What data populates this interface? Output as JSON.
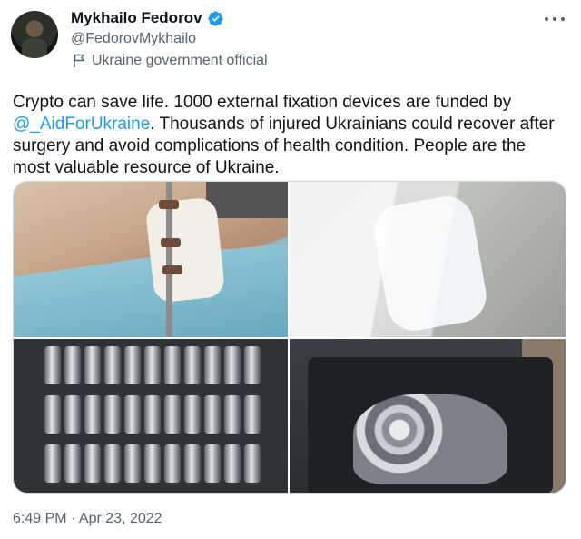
{
  "author": {
    "name": "Mykhailo Fedorov",
    "handle": "@FedorovMykhailo",
    "affiliation": "Ukraine government official",
    "verified": true,
    "verified_color": "#1d9bf0"
  },
  "tweet": {
    "text_before_mention": "Crypto can save life. 1000 external fixation devices are funded by ",
    "mention": "@_AidForUkraine",
    "text_after_mention": ". Thousands of injured Ukrainians could recover after surgery and avoid  complications of health condition. People are the most valuable resource of Ukraine.",
    "timestamp": "6:49 PM · Apr 23, 2022"
  },
  "icons": {
    "verified": "verified-badge-icon",
    "affiliation": "flag-icon",
    "more": "more-options-icon"
  },
  "colors": {
    "text": "#0f1419",
    "secondary": "#536471",
    "link": "#1d9bf0"
  }
}
